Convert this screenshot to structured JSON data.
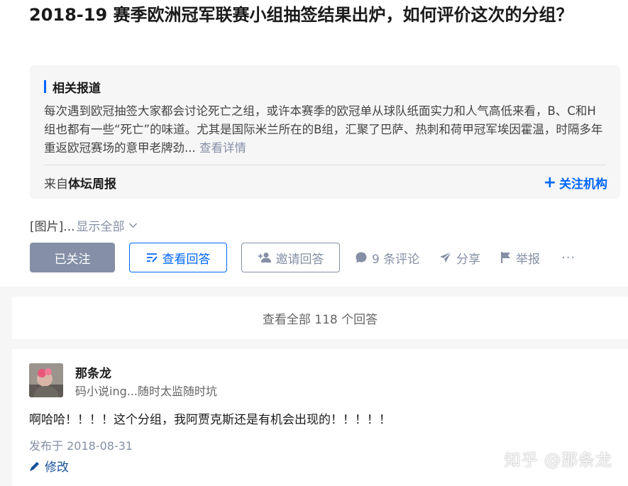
{
  "question": {
    "title": "2018-19 赛季欧洲冠军联赛小组抽签结果出炉，如何评价这次的分组？"
  },
  "related": {
    "heading": "相关报道",
    "excerpt": "每次遇到欧冠抽签大家都会讨论死亡之组，或许本赛季的欧冠单从球队纸面实力和人气高低来看，B、C和H组也都有一些“死亡”的味道。尤其是国际米兰所在的B组，汇聚了巴萨、热刺和荷甲冠军埃因霍温，时隔多年重返欧冠赛场的意甲老牌劲...",
    "more_link": "查看详情",
    "source_prefix": "来自",
    "source_name": "体坛周报",
    "follow_org_label": "关注机构"
  },
  "image_line": {
    "text": "[图片]...",
    "show_all": "显示全部"
  },
  "buttons": {
    "followed": "已关注",
    "view_answers": "查看回答",
    "invite": "邀请回答"
  },
  "actions": {
    "comments": "9 条评论",
    "share": "分享",
    "report": "举报",
    "more": "···"
  },
  "view_all": {
    "label": "查看全部 118 个回答"
  },
  "answer": {
    "author": "那条龙",
    "bio": "码小说ing...随时太监随时坑",
    "text": "啊哈哈！！！！这个分组，我阿贾克斯还是有机会出现的！！！！！",
    "date": "发布于 2018-08-31",
    "edit": "修改"
  },
  "watermark": "知乎 @那条龙",
  "colors": {
    "brand_blue": "#0066ff",
    "grey": "#8590a6",
    "link_blue": "#175199"
  },
  "icons": [
    "view-answers-icon",
    "invite-icon",
    "comment-icon",
    "share-icon",
    "report-icon",
    "more-icon",
    "edit-icon",
    "plus-icon",
    "chevron-down-icon"
  ]
}
